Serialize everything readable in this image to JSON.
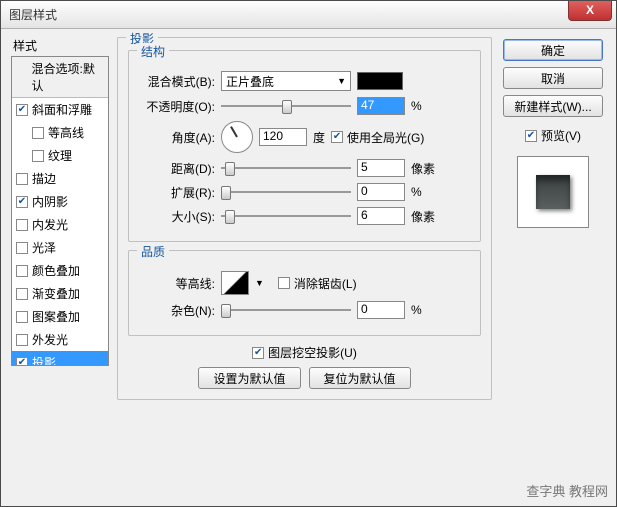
{
  "window": {
    "title": "图层样式"
  },
  "close_label": "X",
  "left": {
    "label": "样式",
    "blend_header": "混合选项:默认",
    "items": [
      {
        "label": "斜面和浮雕",
        "checked": true,
        "indent": 0
      },
      {
        "label": "等高线",
        "checked": false,
        "indent": 1
      },
      {
        "label": "纹理",
        "checked": false,
        "indent": 1
      },
      {
        "label": "描边",
        "checked": false,
        "indent": 0
      },
      {
        "label": "内阴影",
        "checked": true,
        "indent": 0
      },
      {
        "label": "内发光",
        "checked": false,
        "indent": 0
      },
      {
        "label": "光泽",
        "checked": false,
        "indent": 0
      },
      {
        "label": "颜色叠加",
        "checked": false,
        "indent": 0
      },
      {
        "label": "渐变叠加",
        "checked": false,
        "indent": 0
      },
      {
        "label": "图案叠加",
        "checked": false,
        "indent": 0
      },
      {
        "label": "外发光",
        "checked": false,
        "indent": 0
      },
      {
        "label": "投影",
        "checked": true,
        "indent": 0,
        "selected": true
      }
    ]
  },
  "center": {
    "main_title": "投影",
    "struct_title": "结构",
    "blend_mode_label": "混合模式(B):",
    "blend_mode_value": "正片叠底",
    "opacity_label": "不透明度(O):",
    "opacity_value": "47",
    "opacity_unit": "%",
    "angle_label": "角度(A):",
    "angle_value": "120",
    "angle_unit": "度",
    "global_light_label": "使用全局光(G)",
    "global_light_checked": true,
    "distance_label": "距离(D):",
    "distance_value": "5",
    "distance_unit": "像素",
    "spread_label": "扩展(R):",
    "spread_value": "0",
    "spread_unit": "%",
    "size_label": "大小(S):",
    "size_value": "6",
    "size_unit": "像素",
    "quality_title": "品质",
    "contour_label": "等高线:",
    "antialias_label": "消除锯齿(L)",
    "antialias_checked": false,
    "noise_label": "杂色(N):",
    "noise_value": "0",
    "noise_unit": "%",
    "knockout_label": "图层挖空投影(U)",
    "knockout_checked": true,
    "btn_default": "设置为默认值",
    "btn_reset": "复位为默认值"
  },
  "right": {
    "ok": "确定",
    "cancel": "取消",
    "new_style": "新建样式(W)...",
    "preview_label": "预览(V)",
    "preview_checked": true
  },
  "watermark": "查字典 教程网"
}
